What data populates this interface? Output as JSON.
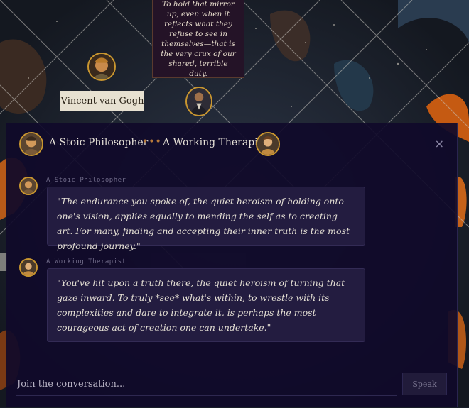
{
  "background": {
    "quote": "To hold that mirror up, even when it reflects what they refuse to see in themselves—that is the very crux of our shared, terrible duty.",
    "name_tag": "Vincent van Gogh",
    "avatars": [
      "van-gogh-portrait",
      "figure-portrait"
    ]
  },
  "dialog": {
    "participants": [
      {
        "name": "A Stoic Philosopher",
        "avatar": "stoic-portrait"
      },
      {
        "name": "A Working Therapist",
        "avatar": "therapist-portrait"
      }
    ],
    "separator": "•••",
    "close_label": "×",
    "messages": [
      {
        "author": "A Stoic Philosopher",
        "text": "\"The endurance you spoke of, the quiet heroism of holding onto one's vision, applies equally to mending the self as to creating art. For many, finding and accepting their inner truth is the most profound journey.\""
      },
      {
        "author": "A Working Therapist",
        "text": "\"You've hit upon a truth there, the quiet heroism of turning that gaze inward. To truly *see* what's within, to wrestle with its complexities and dare to integrate it, is perhaps the most courageous act of creation one can undertake.\""
      }
    ],
    "input_placeholder": "Join the conversation...",
    "speak_label": "Speak"
  },
  "colors": {
    "dialog_bg": "#100a2a",
    "bubble_bg": "#231c40",
    "accent": "#c9962f",
    "text": "#e4dfd4"
  }
}
